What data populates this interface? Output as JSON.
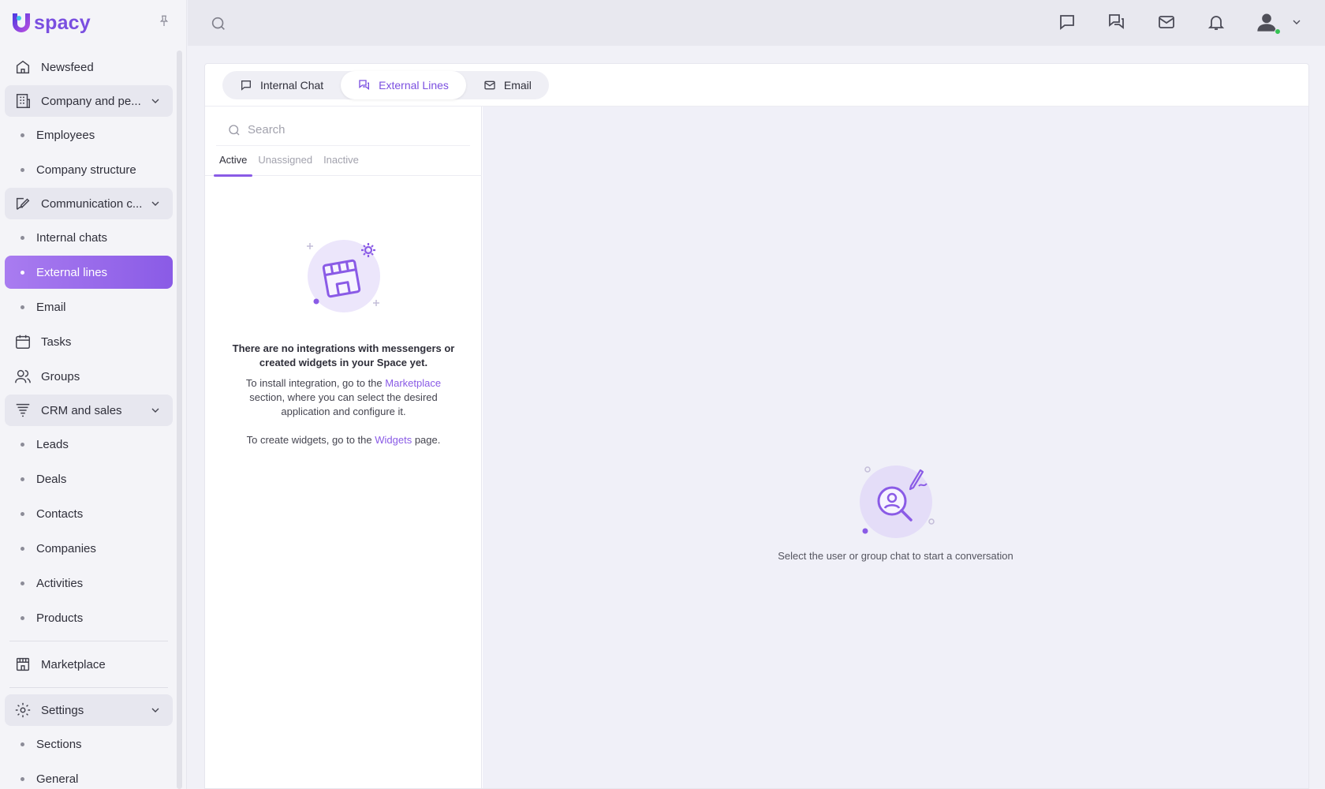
{
  "app": {
    "logo_text": "spacy"
  },
  "sidebar": {
    "items": [
      {
        "label": "Newsfeed"
      },
      {
        "label": "Company and pe..."
      },
      {
        "label": "Employees"
      },
      {
        "label": "Company structure"
      },
      {
        "label": "Communication c..."
      },
      {
        "label": "Internal chats"
      },
      {
        "label": "External lines"
      },
      {
        "label": "Email"
      },
      {
        "label": "Tasks"
      },
      {
        "label": "Groups"
      },
      {
        "label": "CRM and sales"
      },
      {
        "label": "Leads"
      },
      {
        "label": "Deals"
      },
      {
        "label": "Contacts"
      },
      {
        "label": "Companies"
      },
      {
        "label": "Activities"
      },
      {
        "label": "Products"
      },
      {
        "label": "Marketplace"
      },
      {
        "label": "Settings"
      },
      {
        "label": "Sections"
      },
      {
        "label": "General"
      }
    ]
  },
  "tabs": [
    {
      "label": "Internal Chat"
    },
    {
      "label": "External Lines"
    },
    {
      "label": "Email"
    }
  ],
  "search": {
    "placeholder": "Search"
  },
  "subtabs": [
    {
      "label": "Active"
    },
    {
      "label": "Unassigned"
    },
    {
      "label": "Inactive"
    }
  ],
  "empty_left": {
    "title": "There are no integrations with messengers or created widgets in your Space yet.",
    "text_pre": "To install integration, go to the ",
    "marketplace_link": "Marketplace",
    "text_post": " section, where you can select the desired application and configure it.",
    "widgets_pre": "To create widgets, go to the ",
    "widgets_link": "Widgets",
    "widgets_post": " page."
  },
  "empty_right": {
    "text": "Select the user or group chat to start a conversation"
  },
  "colors": {
    "accent": "#8a5be6",
    "active_nav_start": "#a97cf0",
    "active_nav_end": "#8a5be6",
    "status_online": "#36c353"
  }
}
